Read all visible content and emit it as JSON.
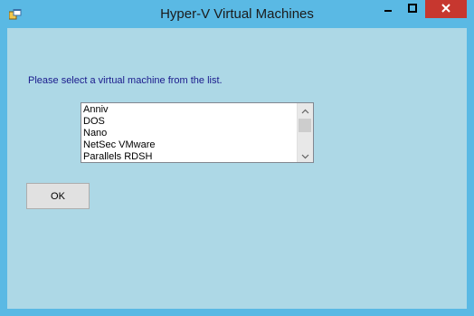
{
  "window": {
    "title": "Hyper-V Virtual Machines",
    "icons": {
      "app": "app-window-icon",
      "minimize": "minimize-icon",
      "maximize": "maximize-icon",
      "close": "close-icon"
    },
    "colors": {
      "frame": "#5ab9e4",
      "client": "#add8e6",
      "close_button": "#c7372f"
    }
  },
  "prompt": "Please select a virtual machine from the list.",
  "vm_list": {
    "items": [
      "Anniv",
      "DOS",
      "Nano",
      "NetSec VMware",
      "Parallels RDSH"
    ]
  },
  "ok_label": "OK"
}
